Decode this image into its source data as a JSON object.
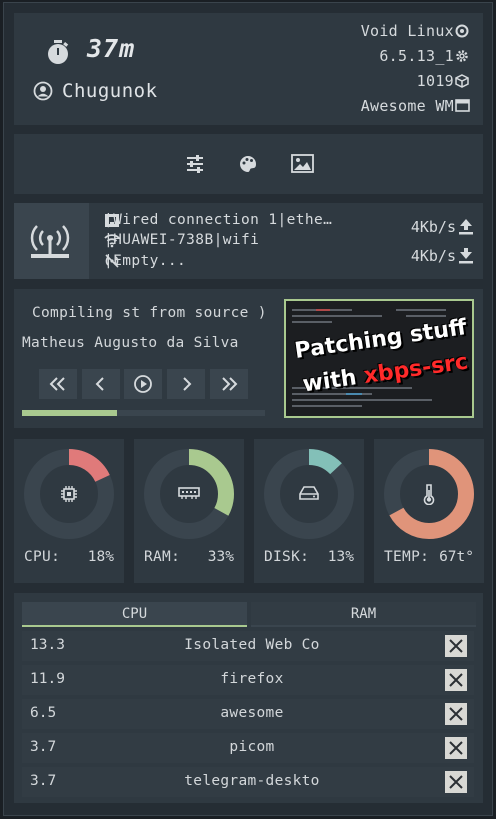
{
  "header": {
    "uptime": "37m",
    "username": "Chugunok",
    "os": "Void Linux",
    "kernel": "6.5.13_1",
    "packages": "1019",
    "wm": "Awesome WM"
  },
  "quick_actions": [
    "settings-sliders-icon",
    "palette-icon",
    "image-icon"
  ],
  "network": {
    "connections": [
      {
        "name": "Wired connection 1",
        "type": "ethe…",
        "icon": "ethernet-icon"
      },
      {
        "name": "HUAWEI-738B",
        "type": "wifi",
        "icon": "wifi-icon"
      },
      {
        "name": "Empty...",
        "type": "",
        "icon": "antenna-off-icon"
      }
    ],
    "upload": "4Kb/s",
    "download": "4Kb/s"
  },
  "media": {
    "title": "Compiling st from source )",
    "artist": "Matheus Augusto da Silva",
    "progress": 0.39,
    "cover_text_line1": "Patching stuff",
    "cover_text_line2_a": "with ",
    "cover_text_line2_b": "xbps-src"
  },
  "gauges": [
    {
      "label": "CPU:",
      "value": "18%",
      "fraction": 0.18,
      "color": "#e07a7a",
      "icon": "cpu-icon"
    },
    {
      "label": "RAM:",
      "value": "33%",
      "fraction": 0.33,
      "color": "#a9c98f",
      "icon": "memory-icon"
    },
    {
      "label": "DISK:",
      "value": "13%",
      "fraction": 0.13,
      "color": "#83c0b8",
      "icon": "disk-icon"
    },
    {
      "label": "TEMP:",
      "value": "67t°",
      "fraction": 0.67,
      "color": "#e0947a",
      "icon": "thermometer-icon"
    }
  ],
  "processes": {
    "tabs": [
      "CPU",
      "RAM"
    ],
    "active_tab": "CPU",
    "rows": [
      {
        "value": "13.3",
        "name": "Isolated Web Co"
      },
      {
        "value": "11.9",
        "name": "firefox"
      },
      {
        "value": "6.5",
        "name": "awesome"
      },
      {
        "value": "3.7",
        "name": "picom"
      },
      {
        "value": "3.7",
        "name": "telegram-deskto"
      }
    ]
  }
}
